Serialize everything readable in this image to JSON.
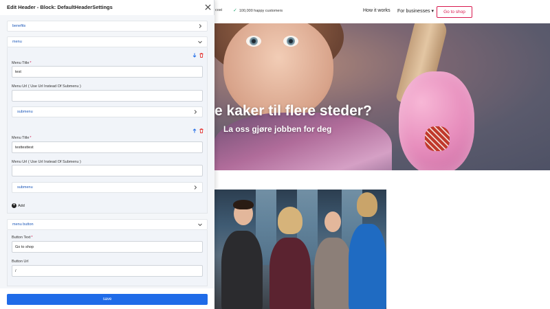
{
  "site": {
    "badges": [
      "cost",
      "100,000 happy customers"
    ],
    "nav": {
      "how_it_works": "How it works",
      "for_businesses": "For businesses",
      "cta": "Go to shop"
    },
    "hero": {
      "title": "e kaker til flere steder?",
      "subtitle": "La oss gjøre jobben for deg"
    }
  },
  "panel": {
    "title": "Edit Header - Block: DefaultHeaderSettings",
    "sections": {
      "benefits": "benefits",
      "menu": "menu",
      "menu_button": "menu button"
    },
    "menu_items": [
      {
        "title_label": "Menu Title",
        "title_value": "test",
        "url_label": "Menu Url ( Use Url Instead Of Submenu )",
        "url_value": "",
        "submenu_label": "submenu"
      },
      {
        "title_label": "Menu Title",
        "title_value": "testtesttest",
        "url_label": "Menu Url ( Use Url Instead Of Submenu )",
        "url_value": "",
        "submenu_label": "submenu"
      }
    ],
    "add_label": "Add",
    "menu_button": {
      "text_label": "Button Text",
      "text_value": "Go to shop",
      "url_label": "Button Url",
      "url_value": "/"
    },
    "required_mark": "*",
    "save_label": "save"
  },
  "colors": {
    "accent_blue": "#1f6be8",
    "link_blue": "#1a56b8",
    "cta_pink": "#d8174d",
    "delete_red": "#e53935"
  }
}
